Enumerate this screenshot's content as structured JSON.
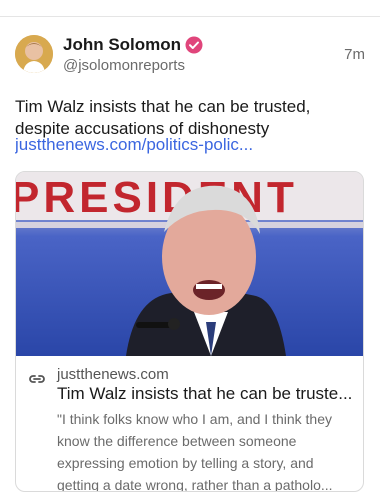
{
  "post": {
    "author_name": "John Solomon",
    "author_handle": "@jsolomonreports",
    "timestamp": "7m",
    "text": "Tim Walz insists that he can be trusted, despite accusations of dishonesty",
    "link_text": "justthenews.com/politics-polic..."
  },
  "link_card": {
    "image_sign_text": "PRESIDENT",
    "domain": "justthenews.com",
    "title": "Tim Walz insists that he can be truste...",
    "description": "\"I think folks know who I am, and I think they know the difference between someone expressing emotion by telling a story, and getting a date wrong, rather than a patholo..."
  },
  "icons": {
    "verified": "verified-badge-icon",
    "link": "link-icon"
  },
  "colors": {
    "link": "#3b66e0",
    "verified_badge": "#e0457b",
    "secondary_text": "#6b6b6b"
  }
}
